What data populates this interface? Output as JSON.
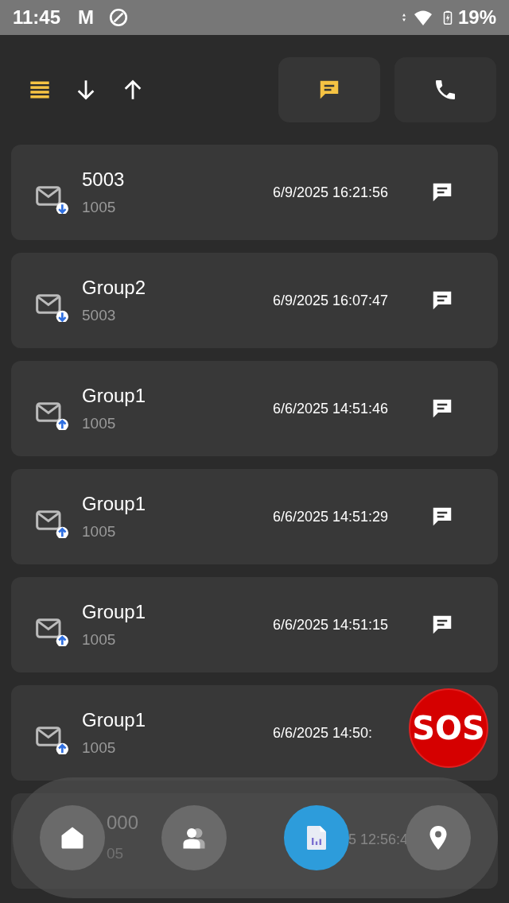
{
  "status_bar": {
    "time": "11:45",
    "carrier": "M",
    "battery": "19%"
  },
  "filters": [
    {
      "kind": "message",
      "selected": true
    },
    {
      "kind": "call",
      "selected": false
    }
  ],
  "list_view_selected": true,
  "messages": [
    {
      "title": "5003",
      "subtitle": "1005",
      "datetime": "6/9/2025 16:21:56",
      "kind": "incoming"
    },
    {
      "title": "Group2",
      "subtitle": "5003",
      "datetime": "6/9/2025 16:07:47",
      "kind": "incoming"
    },
    {
      "title": "Group1",
      "subtitle": "1005",
      "datetime": "6/6/2025 14:51:46",
      "kind": "outgoing"
    },
    {
      "title": "Group1",
      "subtitle": "1005",
      "datetime": "6/6/2025 14:51:29",
      "kind": "outgoing"
    },
    {
      "title": "Group1",
      "subtitle": "1005",
      "datetime": "6/6/2025 14:51:15",
      "kind": "outgoing"
    },
    {
      "title": "Group1",
      "subtitle": "1005",
      "datetime": "6/6/2025 14:50:",
      "kind": "outgoing"
    }
  ],
  "partial_message": {
    "title": "000",
    "subtitle": "05",
    "datetime": "5 12:56:4"
  },
  "sos": "SOS",
  "nav": [
    {
      "kind": "home",
      "selected": false
    },
    {
      "kind": "contacts",
      "selected": false
    },
    {
      "kind": "reports",
      "selected": true
    },
    {
      "kind": "location",
      "selected": false
    }
  ]
}
